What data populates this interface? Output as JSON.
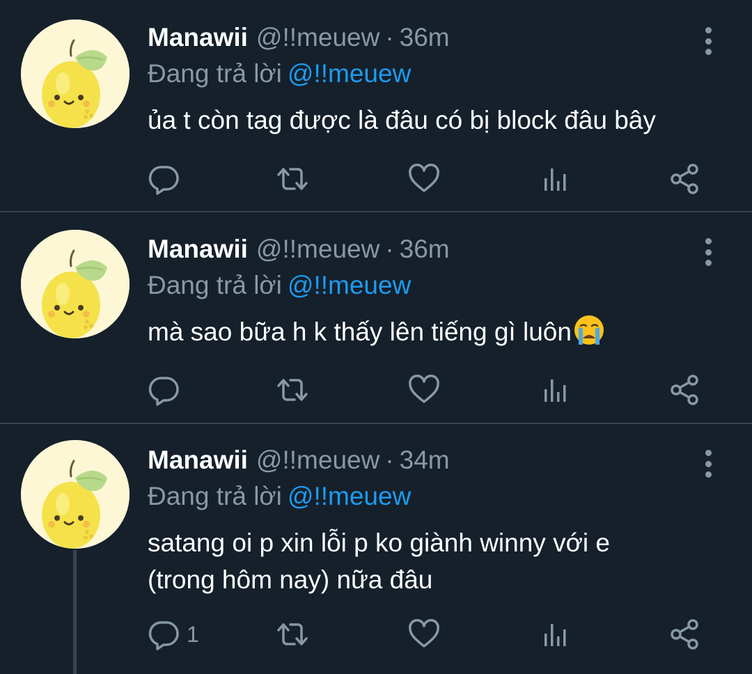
{
  "tweets": [
    {
      "name": "Manawii",
      "handle": "@!!meuew",
      "separator": "·",
      "time": "36m",
      "reply_prefix": "Đang trả lời",
      "reply_to": "@!!meuew",
      "text": "ủa t còn tag được là đâu có bị block đâu bây",
      "reply_count": ""
    },
    {
      "name": "Manawii",
      "handle": "@!!meuew",
      "separator": "·",
      "time": "36m",
      "reply_prefix": "Đang trả lời",
      "reply_to": "@!!meuew",
      "text": "mà sao bữa h k thấy lên tiếng gì luôn",
      "reply_count": ""
    },
    {
      "name": "Manawii",
      "handle": "@!!meuew",
      "separator": "·",
      "time": "34m",
      "reply_prefix": "Đang trả lời",
      "reply_to": "@!!meuew",
      "text_line1": "satang oi p xin lỗi p ko giành winny với e",
      "text_line2": "(trong hôm nay) nữa đâu",
      "reply_count": "1"
    }
  ],
  "colors": {
    "background": "#15202b",
    "divider": "#38444d",
    "secondary_text": "#8899a6",
    "mention": "#1d9bf0"
  },
  "icons": [
    "lemon-avatar",
    "more-vertical-icon",
    "reply-icon",
    "retweet-icon",
    "like-icon",
    "analytics-icon",
    "share-icon",
    "crying-face-emoji"
  ]
}
